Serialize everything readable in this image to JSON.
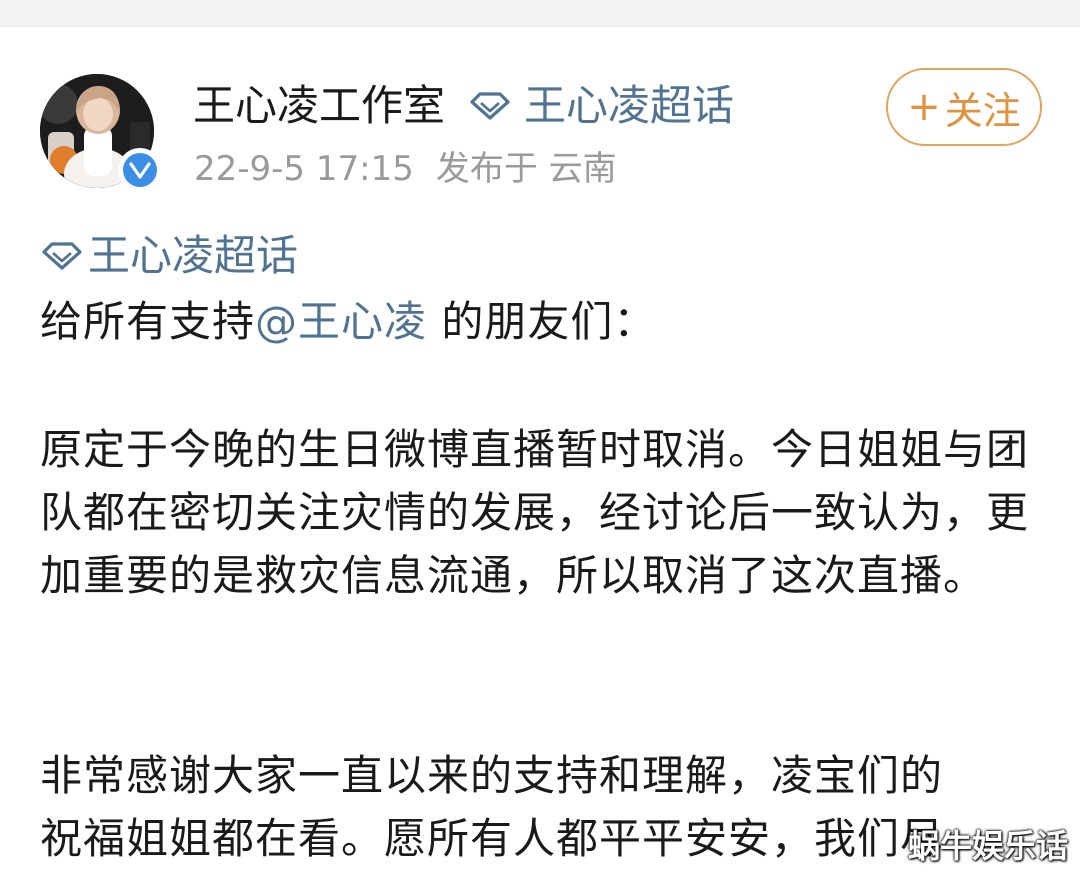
{
  "post": {
    "author_name": "王心凌工作室",
    "supertopic_label": "王心凌超话",
    "follow_label": "关注",
    "follow_plus": "+",
    "date": "22-9-5 17:15",
    "location": "发布于 云南",
    "topic_link": "王心凌超话",
    "greeting_prefix": "给所有支持",
    "mention": "@王心凌",
    "greeting_suffix": " 的朋友们：",
    "paragraph1": "原定于今晚的生日微博直播暂时取消。今日姐姐与团队都在密切关注灾情的发展，经讨论后一致认为，更加重要的是救灾信息流通，所以取消了这次直播。",
    "paragraph2_line1": "非常感谢大家一直以来的支持和理解，凌宝们的",
    "paragraph2_line2": "祝福姐姐都在看。愿所有人都平平安安，我们尽"
  },
  "watermark": "蜗牛娱乐话",
  "colors": {
    "link": "#4f7391",
    "follow": "#e0923e",
    "verified": "#3a8ee6",
    "meta": "#9a9a9a"
  },
  "icons": {
    "supertopic": "diamond-icon",
    "verified": "verified-check-icon"
  }
}
